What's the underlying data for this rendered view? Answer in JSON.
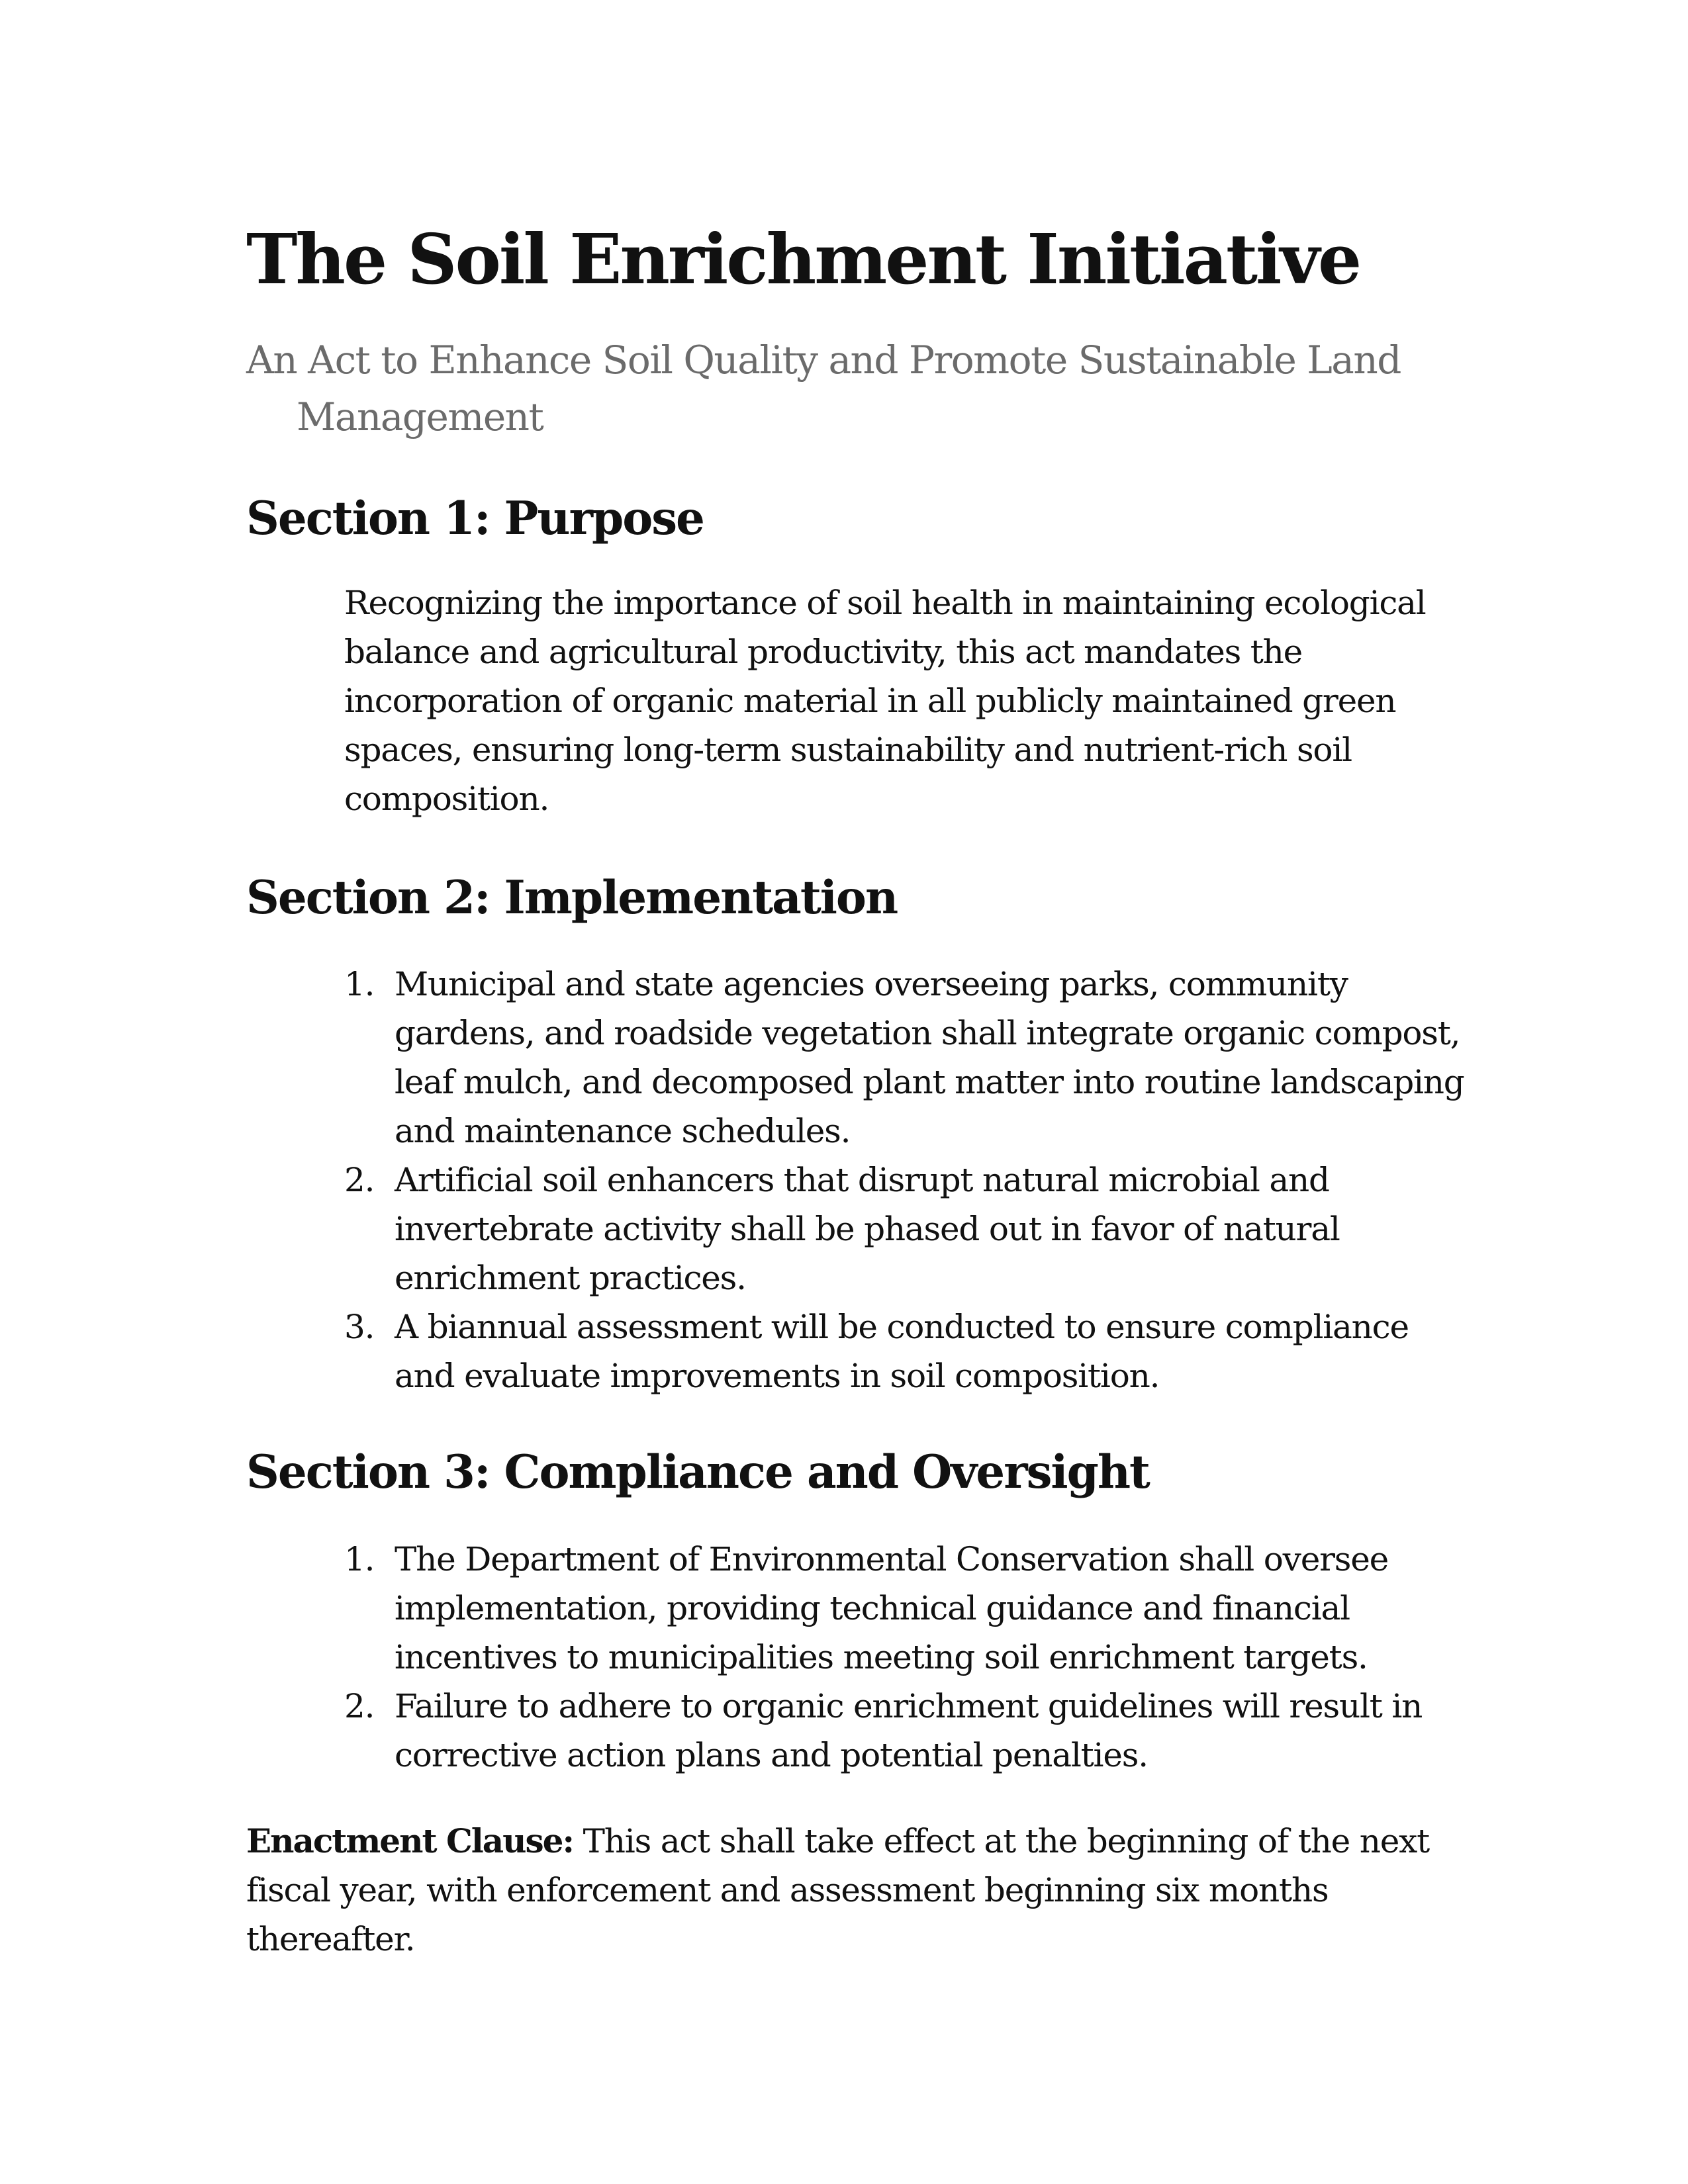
{
  "title": "The Soil Enrichment Initiative",
  "subtitle": "An Act to Enhance Soil Quality and Promote Sustainable Land Management",
  "sections": [
    {
      "heading": "Section 1: Purpose",
      "paragraph": "Recognizing the importance of soil health in maintaining ecological balance and agricultural productivity, this act mandates the incorporation of organic material in all publicly maintained green spaces, ensuring long-term sustainability and nutrient-rich soil composition."
    },
    {
      "heading": "Section 2: Implementation",
      "items": [
        {
          "number": "1.",
          "text": "Municipal and state agencies overseeing parks, community gardens, and roadside vegetation shall integrate organic compost, leaf mulch, and decomposed plant matter into routine landscaping and maintenance schedules."
        },
        {
          "number": "2.",
          "text": "Artificial soil enhancers that disrupt natural microbial and invertebrate activity shall be phased out in favor of natural enrichment practices."
        },
        {
          "number": "3.",
          "text": "A biannual assessment will be conducted to ensure compliance and evaluate improvements in soil composition."
        }
      ]
    },
    {
      "heading": "Section 3: Compliance and Oversight",
      "items": [
        {
          "number": "1.",
          "text": "The Department of Environmental Conservation shall oversee implementation, providing technical guidance and financial incentives to municipalities meeting soil enrichment targets."
        },
        {
          "number": "2.",
          "text": "Failure to adhere to organic enrichment guidelines will result in corrective action plans and potential penalties."
        }
      ]
    }
  ],
  "enactment": {
    "label": "Enactment Clause:",
    "text": "This act shall take effect at the beginning of the next fiscal year, with enforcement and assessment beginning six months thereafter."
  }
}
